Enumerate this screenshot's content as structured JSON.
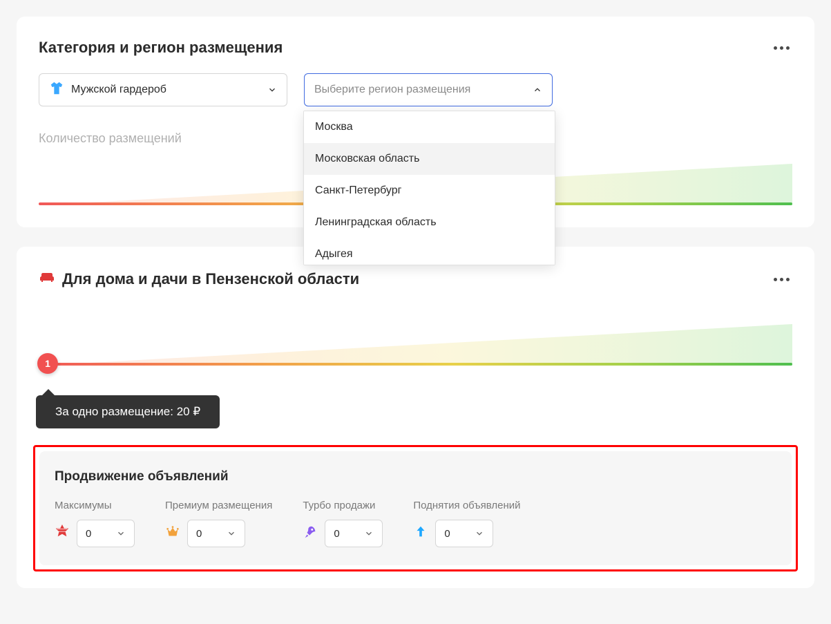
{
  "card1": {
    "title": "Категория и регион размещения",
    "category_select": {
      "value": "Мужской гардероб"
    },
    "region_select": {
      "placeholder": "Выберите регион размещения",
      "options": [
        {
          "label": "Москва",
          "hovered": false
        },
        {
          "label": "Московская область",
          "hovered": true
        },
        {
          "label": "Санкт-Петербург",
          "hovered": false
        },
        {
          "label": "Ленинградская область",
          "hovered": false
        },
        {
          "label": "Адыгея",
          "hovered": false
        }
      ]
    },
    "subheading": "Количество размещений"
  },
  "card2": {
    "title": "Для дома и дачи в Пензенской области",
    "slider_value": "1",
    "tooltip": "За одно размещение: 20 ₽",
    "promo": {
      "title": "Продвижение объявлений",
      "items": [
        {
          "key": "max",
          "label": "Максимумы",
          "value": "0"
        },
        {
          "key": "premium",
          "label": "Премиум размещения",
          "value": "0"
        },
        {
          "key": "turbo",
          "label": "Турбо продажи",
          "value": "0"
        },
        {
          "key": "raise",
          "label": "Поднятия объявлений",
          "value": "0"
        }
      ]
    }
  }
}
